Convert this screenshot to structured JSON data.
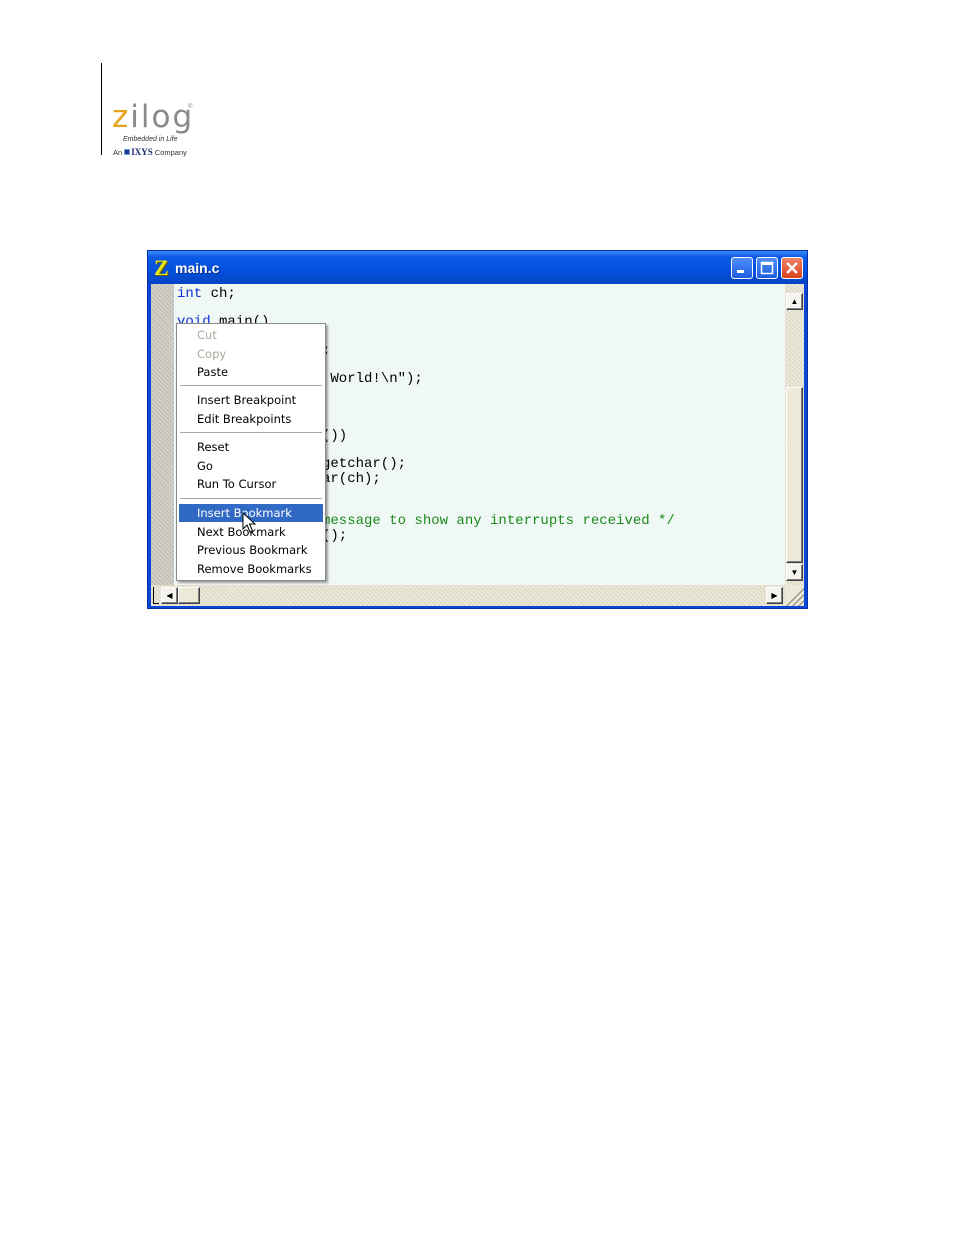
{
  "logo": {
    "wordmark_z": "z",
    "wordmark_rest": "ilog",
    "trademark": "®",
    "tagline": "Embedded in Life",
    "company_prefix": "An",
    "company_brand": "IXYS",
    "company_suffix": "Company"
  },
  "window": {
    "title": "main.c",
    "app_icon": "Z",
    "buttons": {
      "minimize": "minimize-icon",
      "maximize": "maximize-icon",
      "close": "close-icon"
    }
  },
  "code": {
    "line1_kw": "int",
    "line1_rest": " ch;",
    "line2_kw": "void",
    "line2_rest": " main()",
    "line3": ";",
    "line4": " World!\\n\");",
    "line5": "())",
    "line6": "getchar();",
    "line7": "ar(ch);",
    "line8": "message to show any interrupts received */",
    "line9": "();"
  },
  "context_menu": {
    "items": [
      {
        "label": "Cut",
        "enabled": false
      },
      {
        "label": "Copy",
        "enabled": false
      },
      {
        "label": "Paste",
        "enabled": true
      },
      {
        "label": "Insert Breakpoint",
        "enabled": true
      },
      {
        "label": "Edit Breakpoints",
        "enabled": true
      },
      {
        "label": "Reset",
        "enabled": true
      },
      {
        "label": "Go",
        "enabled": true
      },
      {
        "label": "Run To Cursor",
        "enabled": true
      },
      {
        "label": "Insert Bookmark",
        "enabled": true,
        "selected": true
      },
      {
        "label": "Next Bookmark",
        "enabled": true
      },
      {
        "label": "Previous Bookmark",
        "enabled": true
      },
      {
        "label": "Remove Bookmarks",
        "enabled": true
      }
    ]
  },
  "colors": {
    "titlebar": "#0550dc",
    "editor_background": "#f0f8f6",
    "keyword": "#1030d8",
    "comment": "#1a8a1a",
    "menu_highlight": "#316ac5"
  }
}
